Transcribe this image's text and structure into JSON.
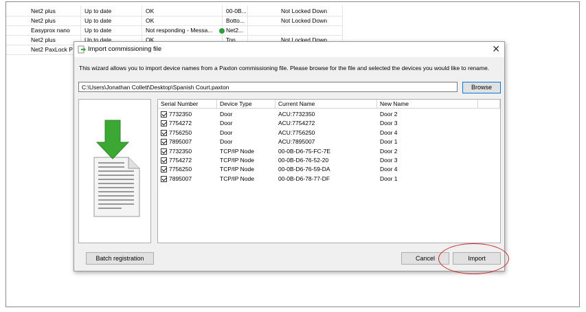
{
  "background_list": {
    "rows": [
      {
        "name": "Net2 plus",
        "status": "Up to date",
        "state": "OK",
        "mac": "00-0B...",
        "lock": "Not Locked Down",
        "dot": false
      },
      {
        "name": "Net2 plus",
        "status": "Up to date",
        "state": "OK",
        "mac": "Botto...",
        "lock": "Not Locked Down",
        "dot": false
      },
      {
        "name": "Easyprox nano",
        "status": "Up to date",
        "state": "Not responding - Messa...",
        "mac": "Net2...",
        "lock": "",
        "dot": true
      },
      {
        "name": "Net2 plus",
        "status": "Up to date",
        "state": "OK",
        "mac": "Top...",
        "lock": "Not Locked Down",
        "dot": false
      },
      {
        "name": "Net2 PaxLock P",
        "status": "",
        "state": "",
        "mac": "",
        "lock": "",
        "dot": false
      }
    ]
  },
  "dialog": {
    "title": "Import commissioning file",
    "intro": "This wizard allows you to import device names from a Paxton commissioning file. Please browse for the file and selected the devices you would like to rename.",
    "file_path": "C:\\Users\\Jonathan Collett\\Desktop\\Spanish Court.paxton",
    "browse_label": "Browse",
    "columns": [
      "Serial Number",
      "Device Type",
      "Current Name",
      "New Name"
    ],
    "devices": [
      {
        "serial": "7732350",
        "type": "Door",
        "current": "ACU:7732350",
        "new": "Door 2"
      },
      {
        "serial": "7754272",
        "type": "Door",
        "current": "ACU:7754272",
        "new": "Door 3"
      },
      {
        "serial": "7756250",
        "type": "Door",
        "current": "ACU:7756250",
        "new": "Door 4"
      },
      {
        "serial": "7895007",
        "type": "Door",
        "current": "ACU:7895007",
        "new": "Door 1"
      },
      {
        "serial": "7732350",
        "type": "TCP/IP Node",
        "current": "00-0B-D6-75-FC-7E",
        "new": "Door 2"
      },
      {
        "serial": "7754272",
        "type": "TCP/IP Node",
        "current": "00-0B-D6-76-52-20",
        "new": "Door 3"
      },
      {
        "serial": "7756250",
        "type": "TCP/IP Node",
        "current": "00-0B-D6-76-59-DA",
        "new": "Door 4"
      },
      {
        "serial": "7895007",
        "type": "TCP/IP Node",
        "current": "00-0B-D6-78-77-DF",
        "new": "Door 1"
      }
    ],
    "batch_label": "Batch registration",
    "cancel_label": "Cancel",
    "import_label": "Import"
  },
  "icons": {
    "title": "import-wizard-icon",
    "close": "close-icon",
    "illustration": "download-document-icon",
    "status_dot": "status-dot-icon"
  },
  "colors": {
    "highlight_ellipse": "#c8262e",
    "arrow_green": "#3aa832",
    "status_dot": "#2e9e3a",
    "browse_focus": "#0078d7"
  }
}
